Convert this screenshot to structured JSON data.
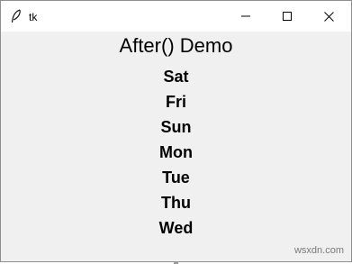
{
  "window": {
    "title": "tk",
    "controls": {
      "minimize": "minimize",
      "maximize": "maximize",
      "close": "close"
    }
  },
  "main": {
    "heading": "After() Demo",
    "days": [
      "Sat",
      "Fri",
      "Sun",
      "Mon",
      "Tue",
      "Thu",
      "Wed"
    ]
  },
  "watermark": "wsxdn.com"
}
